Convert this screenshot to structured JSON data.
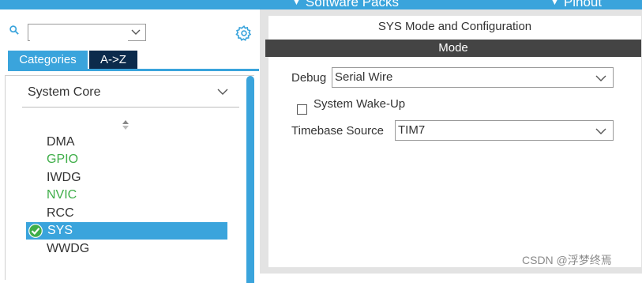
{
  "topbar": {
    "software_packs": "Software Packs",
    "pinout": "Pinout"
  },
  "search": {
    "value": "",
    "placeholder": ""
  },
  "tabs": [
    {
      "label": "Categories",
      "active": true
    },
    {
      "label": "A->Z",
      "active": false
    }
  ],
  "group": {
    "label": "System Core",
    "expanded": true
  },
  "items": [
    {
      "label": "DMA",
      "status": "default"
    },
    {
      "label": "GPIO",
      "status": "configured"
    },
    {
      "label": "IWDG",
      "status": "default"
    },
    {
      "label": "NVIC",
      "status": "configured"
    },
    {
      "label": "RCC",
      "status": "default"
    },
    {
      "label": "SYS",
      "status": "selected-ok"
    },
    {
      "label": "WWDG",
      "status": "default"
    }
  ],
  "panel": {
    "title": "SYS Mode and Configuration",
    "mode_header": "Mode",
    "debug": {
      "label": "Debug",
      "value": "Serial Wire"
    },
    "wakeup": {
      "label": "System Wake-Up",
      "checked": false
    },
    "timebase": {
      "label": "Timebase Source",
      "value": "TIM7"
    }
  },
  "watermark": "CSDN @浮梦终焉",
  "colors": {
    "accent": "#3aa4dc",
    "dark_tab": "#0c2b4c",
    "mode_bar": "#444444",
    "configured_green": "#3fae49"
  },
  "icons": [
    "search-icon",
    "gear-icon",
    "chevron-down-icon",
    "sort-icon",
    "check-circle-icon"
  ]
}
